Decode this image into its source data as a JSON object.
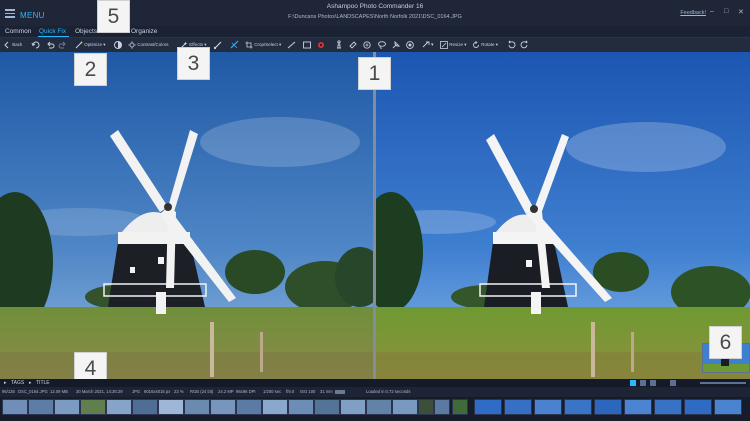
{
  "window": {
    "menu_label": "MENU",
    "app_title": "Ashampoo Photo Commander 16",
    "file_path": "F:\\Duncans Photos\\LANDSCAPES\\North Norfolk 2021\\DSC_0164.JPG",
    "feedback_label": "Feedback!"
  },
  "tabs": [
    {
      "label": "Common"
    },
    {
      "label": "Quick Fix"
    },
    {
      "label": "Objects"
    },
    {
      "label": "Create"
    },
    {
      "label": "Organize"
    }
  ],
  "toolbar": {
    "back_label": "Back",
    "optimize_label": "Optimize",
    "contrast_label": "Contrast/Colors",
    "effects_label": "Effects",
    "crop_label": "Crop/Select",
    "resize_label": "Resize",
    "rotate_label": "Rotate"
  },
  "callouts": [
    "1",
    "2",
    "3",
    "4",
    "5",
    "6"
  ],
  "tagsbar": {
    "tags_label": "TAGS",
    "title_label": "TITLE"
  },
  "infobar": {
    "counter": "96/136",
    "filename": "DSC_0164.JPG",
    "filesize": "12.09 MB",
    "date": "30 March 2021, 14:26:29",
    "format": "JPG",
    "dimensions": "6016x4016 px",
    "zoom": "23 %",
    "color": "RGB (24 bit)",
    "megapixels": "24.2 MP",
    "dpi": "96x96 DPI",
    "exposure": "1/200 sec",
    "aperture": "f/9.0",
    "iso": "ISO 100",
    "focal": "31 mm",
    "loaded": "Loaded in 0.72 seconds"
  },
  "colors": {
    "accent": "#2ab7ff",
    "chrome": "#1b2233",
    "callout_bg": "#f4f4f4"
  }
}
